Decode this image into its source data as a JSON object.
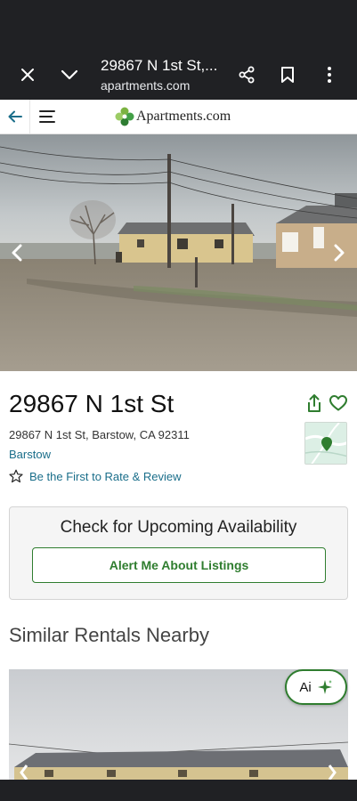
{
  "browser": {
    "title": "29867 N 1st St,...",
    "url": "apartments.com"
  },
  "site": {
    "logo_text": "Apartments.com"
  },
  "listing": {
    "title": "29867 N 1st St",
    "address": "29867 N 1st St, Barstow, CA 92311",
    "city": "Barstow",
    "rate_review": "Be the First to Rate & Review"
  },
  "availability": {
    "heading": "Check for Upcoming Availability",
    "button": "Alert Me About Listings"
  },
  "similar": {
    "heading": "Similar Rentals Nearby"
  },
  "ai_button": {
    "label": "Ai"
  },
  "colors": {
    "brand_green": "#2f7d2f",
    "link_teal": "#1a6e8a",
    "toolbar_dark": "#202124"
  }
}
